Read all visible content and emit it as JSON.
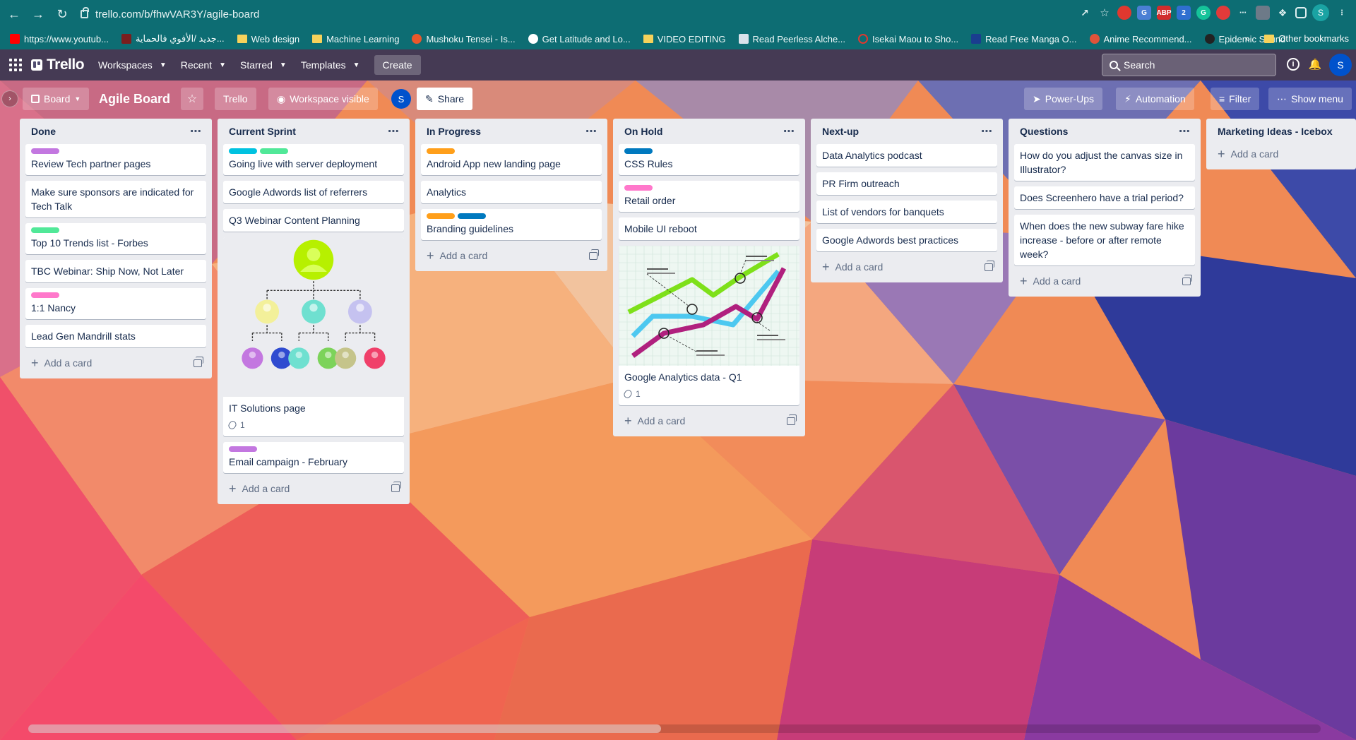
{
  "browser": {
    "url": "trello.com/b/fhwVAR3Y/agile-board",
    "profile_initial": "S",
    "bookmarks": [
      {
        "label": "https://www.youtub..."
      },
      {
        "label": "جديد /الأفوي فالحماية..."
      },
      {
        "label": "Web design"
      },
      {
        "label": "Machine Learning"
      },
      {
        "label": "Mushoku Tensei - Is..."
      },
      {
        "label": "Get Latitude and Lo..."
      },
      {
        "label": "VIDEO EDITING"
      },
      {
        "label": "Read Peerless Alche..."
      },
      {
        "label": "Isekai Maou to Sho..."
      },
      {
        "label": "Read Free Manga O..."
      },
      {
        "label": "Anime Recommend..."
      },
      {
        "label": "Epidemic Sound"
      }
    ],
    "bookmarks_overflow": "»",
    "other_bookmarks": "Other bookmarks"
  },
  "header": {
    "logo": "Trello",
    "menus": [
      "Workspaces",
      "Recent",
      "Starred",
      "Templates"
    ],
    "create": "Create",
    "search_placeholder": "Search",
    "avatar_initial": "S"
  },
  "board": {
    "view": "Board",
    "title": "Agile Board",
    "workspace": "Trello",
    "visibility": "Workspace visible",
    "member_initial": "S",
    "share": "Share",
    "powerups": "Power-Ups",
    "automation": "Automation",
    "filter": "Filter",
    "show_menu": "Show menu",
    "add_card": "Add a card"
  },
  "lists": [
    {
      "title": "Done",
      "cards": [
        {
          "title": "Review Tech partner pages",
          "labels": [
            "#c377e0"
          ]
        },
        {
          "title": "Make sure sponsors are indicated for Tech Talk",
          "labels": []
        },
        {
          "title": "Top 10 Trends list - Forbes",
          "labels": [
            "#51e898"
          ]
        },
        {
          "title": "TBC Webinar: Ship Now, Not Later",
          "labels": []
        },
        {
          "title": "1:1 Nancy",
          "labels": [
            "#ff78cb"
          ]
        },
        {
          "title": "Lead Gen Mandrill stats",
          "labels": []
        }
      ]
    },
    {
      "title": "Current Sprint",
      "cards": [
        {
          "title": "Going live with server deployment",
          "labels": [
            "#00c2e0",
            "#51e898"
          ]
        },
        {
          "title": "Google Adwords list of referrers",
          "labels": []
        },
        {
          "title": "Q3 Webinar Content Planning",
          "labels": []
        },
        {
          "title": "IT Solutions page",
          "labels": [],
          "cover": "org-chart",
          "attachments": "1"
        },
        {
          "title": "Email campaign - February",
          "labels": [
            "#c377e0"
          ]
        }
      ]
    },
    {
      "title": "In Progress",
      "cards": [
        {
          "title": "Android App new landing page",
          "labels": [
            "#ff9f1a"
          ]
        },
        {
          "title": "Analytics",
          "labels": []
        },
        {
          "title": "Branding guidelines",
          "labels": [
            "#ff9f1a",
            "#0079bf"
          ]
        }
      ]
    },
    {
      "title": "On Hold",
      "cards": [
        {
          "title": "CSS Rules",
          "labels": [
            "#0079bf"
          ]
        },
        {
          "title": "Retail order",
          "labels": [
            "#ff78cb"
          ]
        },
        {
          "title": "Mobile UI reboot",
          "labels": []
        },
        {
          "title": "Google Analytics data - Q1",
          "labels": [],
          "cover": "line-chart",
          "attachments": "1"
        }
      ]
    },
    {
      "title": "Next-up",
      "cards": [
        {
          "title": "Data Analytics podcast",
          "labels": []
        },
        {
          "title": "PR Firm outreach",
          "labels": []
        },
        {
          "title": "List of vendors for banquets",
          "labels": []
        },
        {
          "title": "Google Adwords best practices",
          "labels": []
        }
      ]
    },
    {
      "title": "Questions",
      "cards": [
        {
          "title": "How do you adjust the canvas size in Illustrator?",
          "labels": []
        },
        {
          "title": "Does Screenhero have a trial period?",
          "labels": []
        },
        {
          "title": "When does the new subway fare hike increase - before or after remote week?",
          "labels": []
        }
      ]
    },
    {
      "title": "Marketing Ideas - Icebox",
      "cards": []
    }
  ],
  "colors": {
    "chrome": "#0d6d73",
    "header": "#3a3756",
    "list_bg": "#ebecf0"
  }
}
